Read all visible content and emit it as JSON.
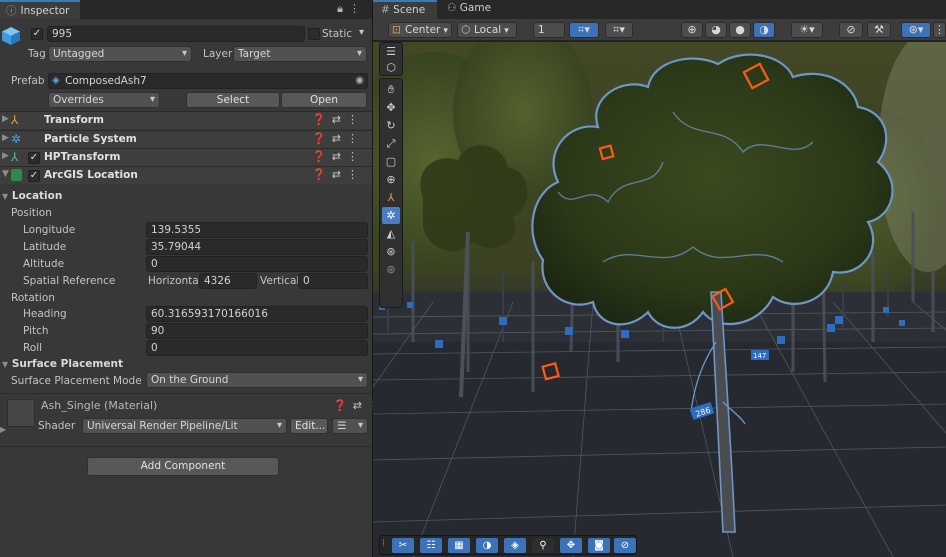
{
  "inspector": {
    "tab_label": "Inspector",
    "object_name": "995",
    "static_label": "Static",
    "tag_label": "Tag",
    "tag_value": "Untagged",
    "layer_label": "Layer",
    "layer_value": "Target",
    "prefab_label": "Prefab",
    "prefab_value": "ComposedAsh7",
    "overrides_label": "Overrides",
    "select_label": "Select",
    "open_label": "Open",
    "components": [
      "Transform",
      "Particle System",
      "HPTransform",
      "ArcGIS Location"
    ],
    "location": {
      "section_title": "Location",
      "position_title": "Position",
      "longitude_label": "Longitude",
      "longitude_value": "139.5355",
      "latitude_label": "Latitude",
      "latitude_value": "35.79044",
      "altitude_label": "Altitude",
      "altitude_value": "0",
      "spatial_ref_label": "Spatial Reference",
      "horizontal_label": "Horizontal",
      "horizontal_value": "4326",
      "vertical_label": "Vertical",
      "vertical_value": "0",
      "rotation_title": "Rotation",
      "heading_label": "Heading",
      "heading_value": "60.316593170166016",
      "pitch_label": "Pitch",
      "pitch_value": "90",
      "roll_label": "Roll",
      "roll_value": "0",
      "surface_title": "Surface Placement",
      "surface_mode_label": "Surface Placement Mode",
      "surface_mode_value": "On the Ground"
    },
    "material": {
      "name": "Ash_Single (Material)",
      "shader_label": "Shader",
      "shader_value": "Universal Render Pipeline/Lit",
      "edit_label": "Edit..."
    },
    "add_component_label": "Add Component"
  },
  "scene": {
    "tabs": [
      "Scene",
      "Game"
    ],
    "pivot_value": "Center",
    "space_value": "Local",
    "grid_value": "1",
    "tree_labels": [
      "286",
      "147"
    ]
  },
  "colors": {
    "accent": "#3a79bb",
    "selection_outline": "#6f96c9",
    "handle_orange": "#ff5a14"
  }
}
